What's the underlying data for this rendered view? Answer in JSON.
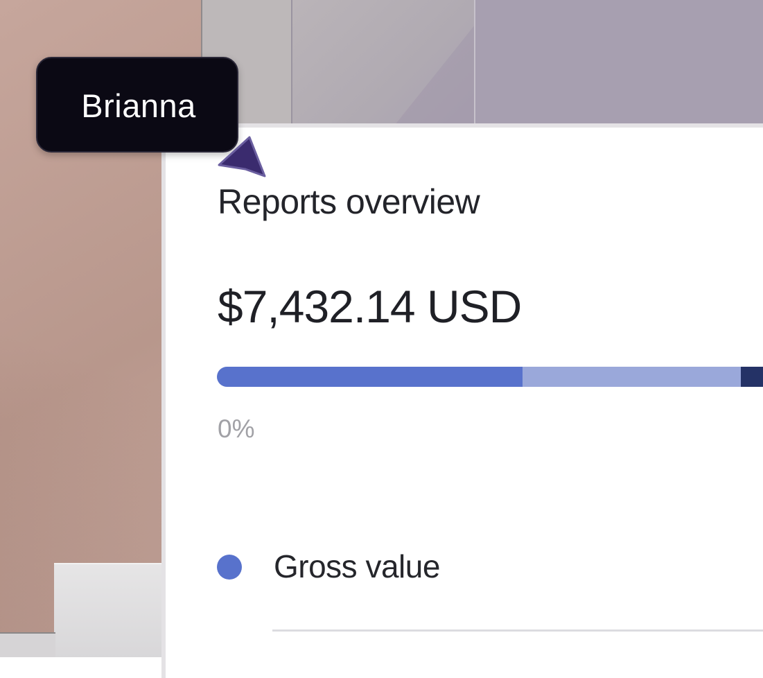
{
  "collaborator": {
    "name": "Brianna",
    "cursor_color": "#3a2b6e"
  },
  "card": {
    "title": "Reports overview",
    "amount": "$7,432.14 USD",
    "progress_label": "0%",
    "segments": [
      {
        "name": "gross-value",
        "fraction": 0.56,
        "color": "#5872cc"
      },
      {
        "name": "segment-2",
        "fraction": 0.4,
        "color": "#9aa8da"
      },
      {
        "name": "segment-3",
        "fraction": 0.04,
        "color": "#243266"
      }
    ],
    "legend": [
      {
        "label": "Gross value",
        "color": "#5872cc"
      }
    ]
  }
}
